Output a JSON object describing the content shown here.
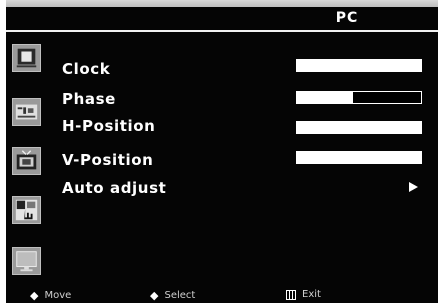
{
  "menu": {
    "title": "PC"
  },
  "sidebar": {
    "icons": [
      "picture-icon",
      "sound-icon",
      "tv-icon",
      "pc-icon",
      "monitor-icon"
    ]
  },
  "items": [
    {
      "label": "Clock",
      "level": 1.0
    },
    {
      "label": "Phase",
      "level": 0.45
    },
    {
      "label": "H-Position",
      "level": 1.0
    },
    {
      "label": "V-Position",
      "level": 1.0
    },
    {
      "label": "Auto adjust"
    }
  ],
  "footer": {
    "move": "Move",
    "select": "Select",
    "exit": "Exit"
  }
}
